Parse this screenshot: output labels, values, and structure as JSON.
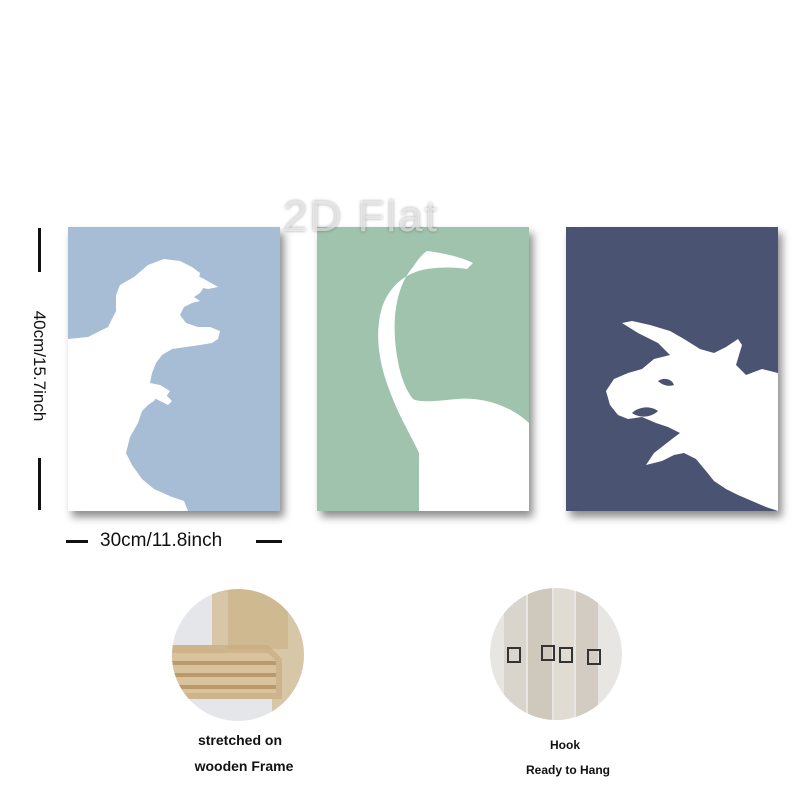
{
  "watermark": "2D Flat",
  "dimensions": {
    "height_label": "40cm/15.7inch",
    "width_label": "30cm/11.8inch"
  },
  "prints": [
    {
      "subject": "t-rex",
      "background": "#a7bdd6"
    },
    {
      "subject": "brachiosaurus",
      "background": "#9fc3ad"
    },
    {
      "subject": "triceratops",
      "background": "#4a5472"
    }
  ],
  "features": {
    "frame": {
      "line1": "stretched on",
      "line2": "wooden Frame"
    },
    "hook": {
      "line1": "Hook",
      "line2": "Ready to Hang"
    }
  },
  "colors": {
    "silhouette": "#ffffff",
    "text": "#111111"
  }
}
